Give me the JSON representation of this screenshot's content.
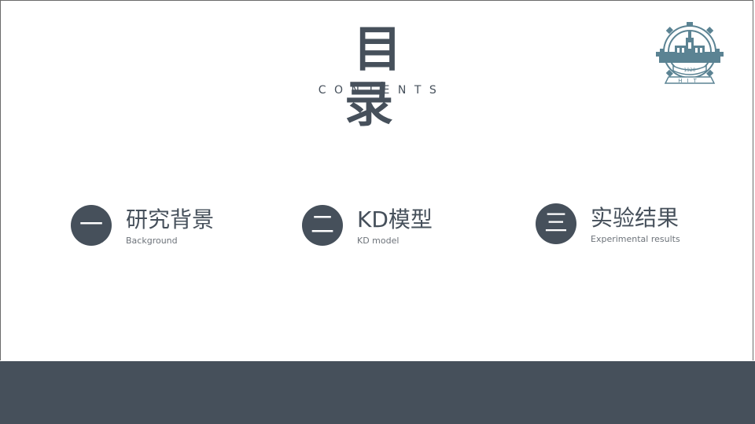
{
  "slide": {
    "title": "目 录",
    "subtitle": "CONTENTS",
    "logo": {
      "icon": "hit-university-emblem-icon",
      "year": "1920",
      "letters": "HIT",
      "color": "#5b8393"
    }
  },
  "sections": [
    {
      "number": "一",
      "title": "研究背景",
      "subtitle": "Background"
    },
    {
      "number": "二",
      "title": "KD模型",
      "subtitle": "KD model"
    },
    {
      "number": "三",
      "title": "实验结果",
      "subtitle": "Experimental results"
    }
  ],
  "colors": {
    "primary": "#46505b",
    "footer": "#46505b",
    "background": "#ffffff"
  }
}
